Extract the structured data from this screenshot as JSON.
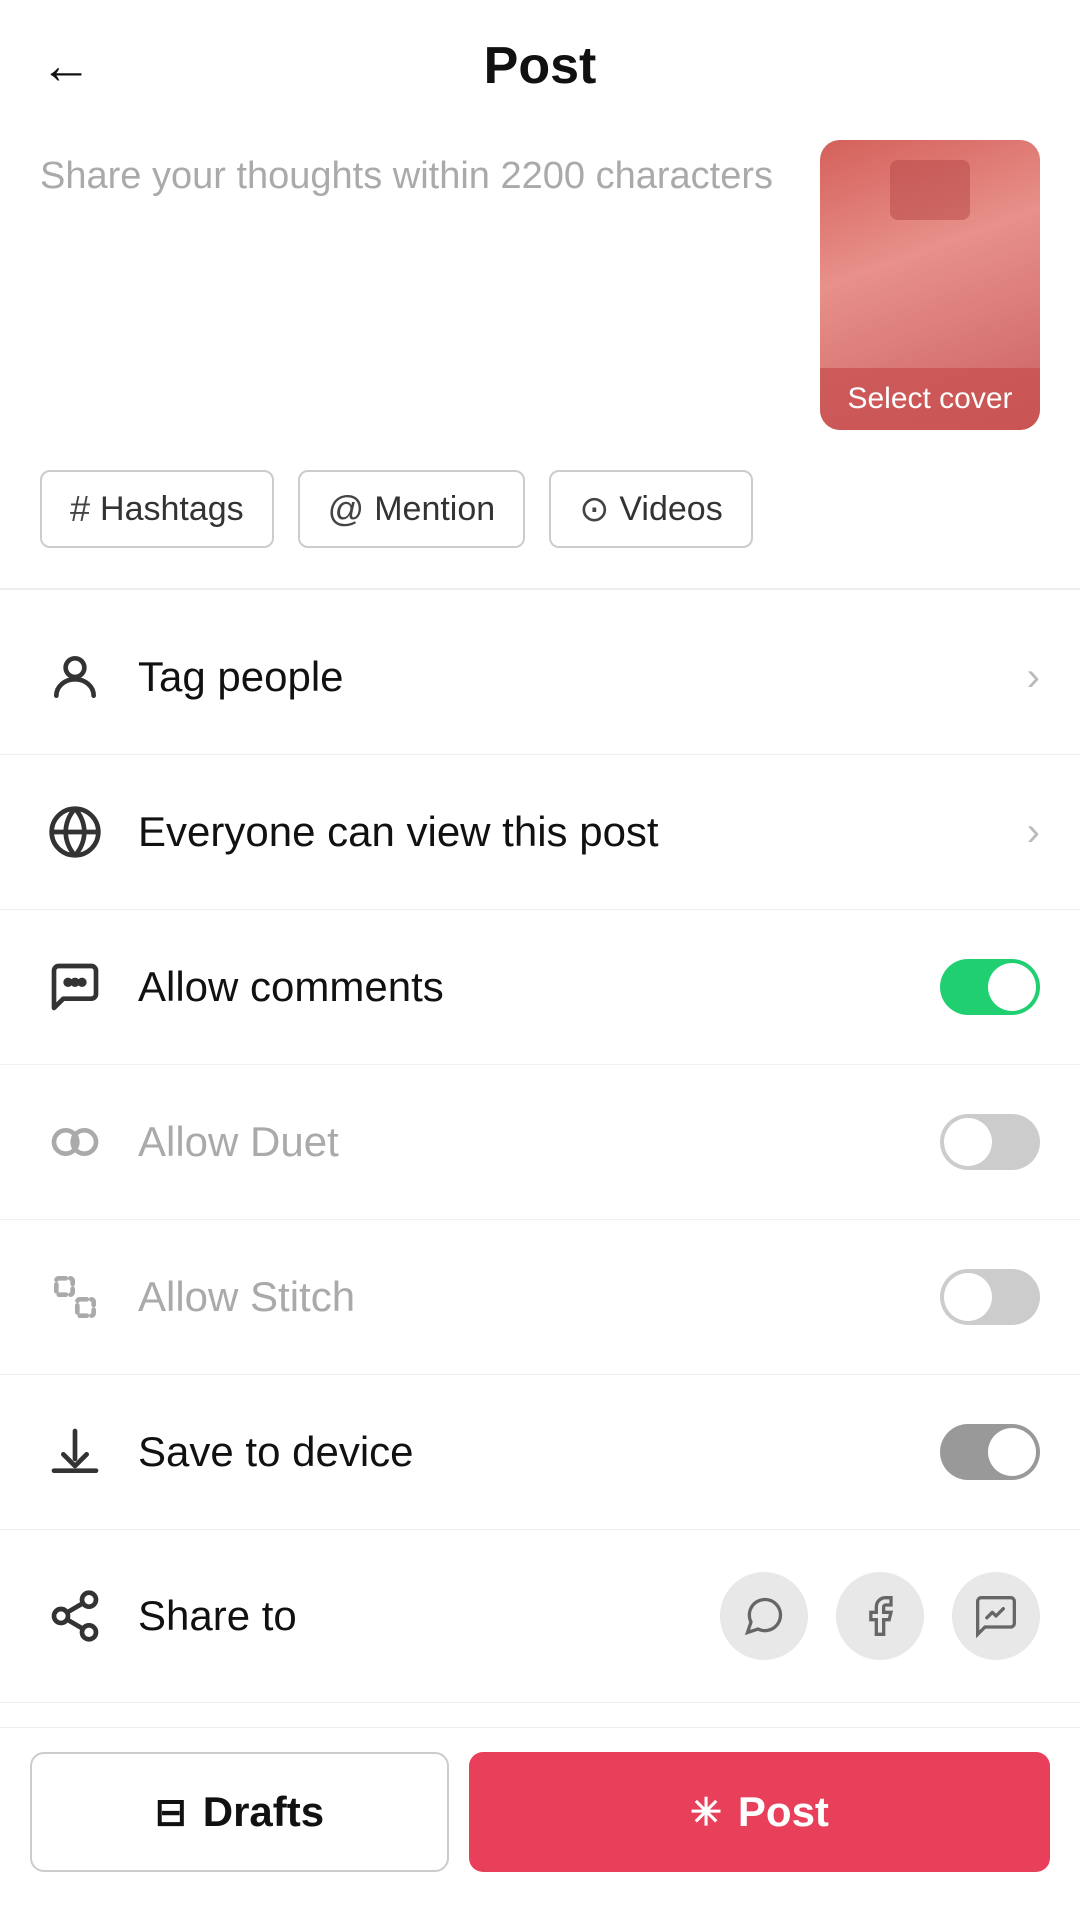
{
  "header": {
    "back_label": "←",
    "title": "Post"
  },
  "caption": {
    "placeholder": "Share your thoughts within 2200 characters",
    "cover_label": "Select cover"
  },
  "tags": [
    {
      "icon": "#",
      "label": "Hashtags"
    },
    {
      "icon": "@",
      "label": "Mention"
    },
    {
      "icon": "▶",
      "label": "Videos"
    }
  ],
  "settings": [
    {
      "id": "tag-people",
      "icon": "person",
      "label": "Tag people",
      "type": "chevron",
      "muted": false
    },
    {
      "id": "view-privacy",
      "icon": "globe",
      "label": "Everyone can view this post",
      "type": "chevron",
      "muted": false
    },
    {
      "id": "allow-comments",
      "icon": "comment",
      "label": "Allow comments",
      "type": "toggle",
      "toggle_state": "on",
      "muted": false
    },
    {
      "id": "allow-duet",
      "icon": "duet",
      "label": "Allow Duet",
      "type": "toggle",
      "toggle_state": "off",
      "muted": true
    },
    {
      "id": "allow-stitch",
      "icon": "stitch",
      "label": "Allow Stitch",
      "type": "toggle",
      "toggle_state": "off",
      "muted": true
    },
    {
      "id": "save-device",
      "icon": "download",
      "label": "Save to device",
      "type": "toggle",
      "toggle_state": "off-dark",
      "muted": false
    },
    {
      "id": "share-to",
      "icon": "share",
      "label": "Share to",
      "type": "share",
      "muted": false
    }
  ],
  "bottom_bar": {
    "drafts_label": "Drafts",
    "post_label": "Post"
  },
  "colors": {
    "accent": "#e8405a",
    "toggle_on": "#20d070",
    "toggle_off": "#cccccc",
    "cover_bg": "#e8827a"
  }
}
